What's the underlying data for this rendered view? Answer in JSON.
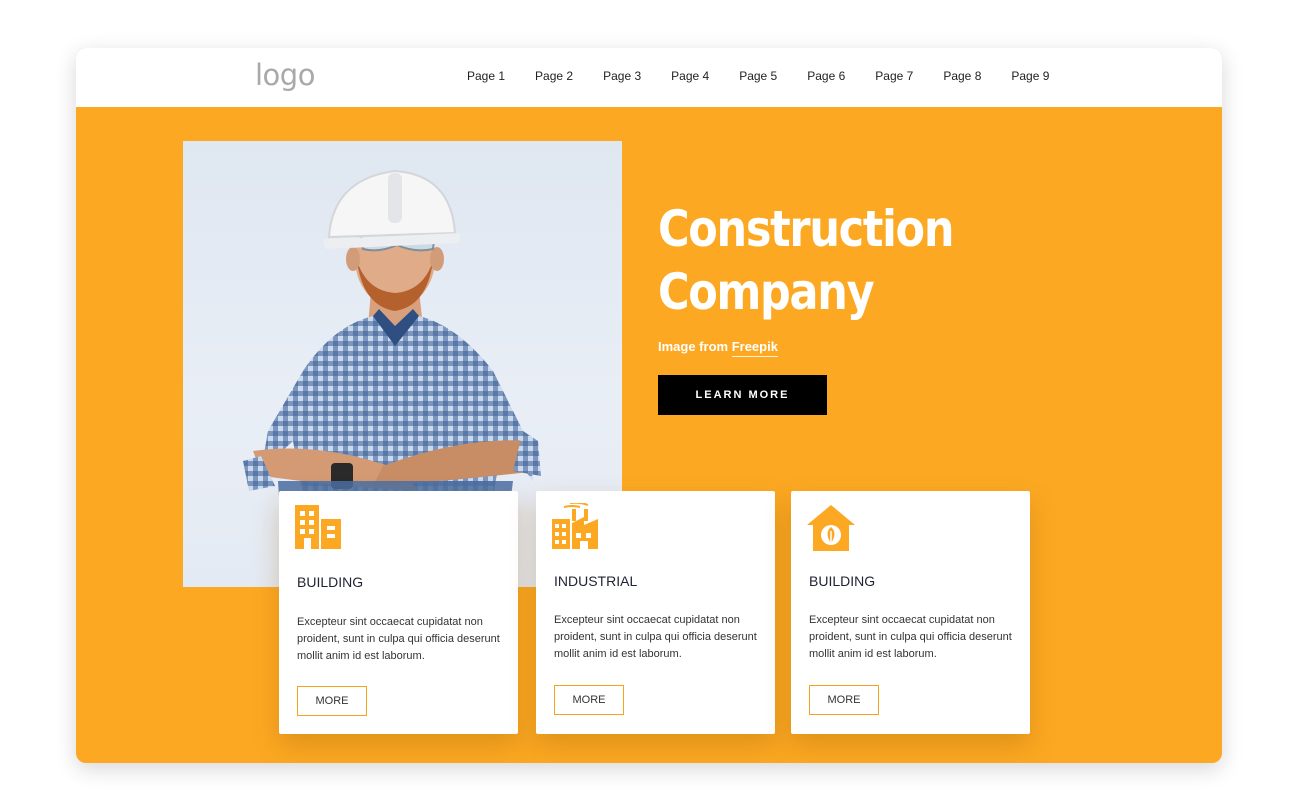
{
  "header": {
    "logo": "logo",
    "nav": [
      "Page 1",
      "Page 2",
      "Page 3",
      "Page 4",
      "Page 5",
      "Page 6",
      "Page 7",
      "Page 8",
      "Page 9"
    ]
  },
  "hero": {
    "title_line1": "Construction",
    "title_line2": "Company",
    "credit_prefix": "Image from ",
    "credit_link": "Freepik",
    "cta": "LEARN MORE"
  },
  "cards": [
    {
      "icon": "building-icon",
      "title": "BUILDING",
      "text": "Excepteur sint occaecat cupidatat non proident, sunt in culpa qui officia deserunt mollit anim id est laborum.",
      "button": "MORE"
    },
    {
      "icon": "factory-icon",
      "title": "INDUSTRIAL",
      "text": "Excepteur sint occaecat cupidatat non proident, sunt in culpa qui officia deserunt mollit anim id est laborum.",
      "button": "MORE"
    },
    {
      "icon": "eco-house-icon",
      "title": "BUILDING",
      "text": "Excepteur sint occaecat cupidatat non proident, sunt in culpa qui officia deserunt mollit anim id est laborum.",
      "button": "MORE"
    }
  ],
  "colors": {
    "accent": "#fca822",
    "cta_bg": "#000000",
    "card_bg": "#ffffff"
  }
}
